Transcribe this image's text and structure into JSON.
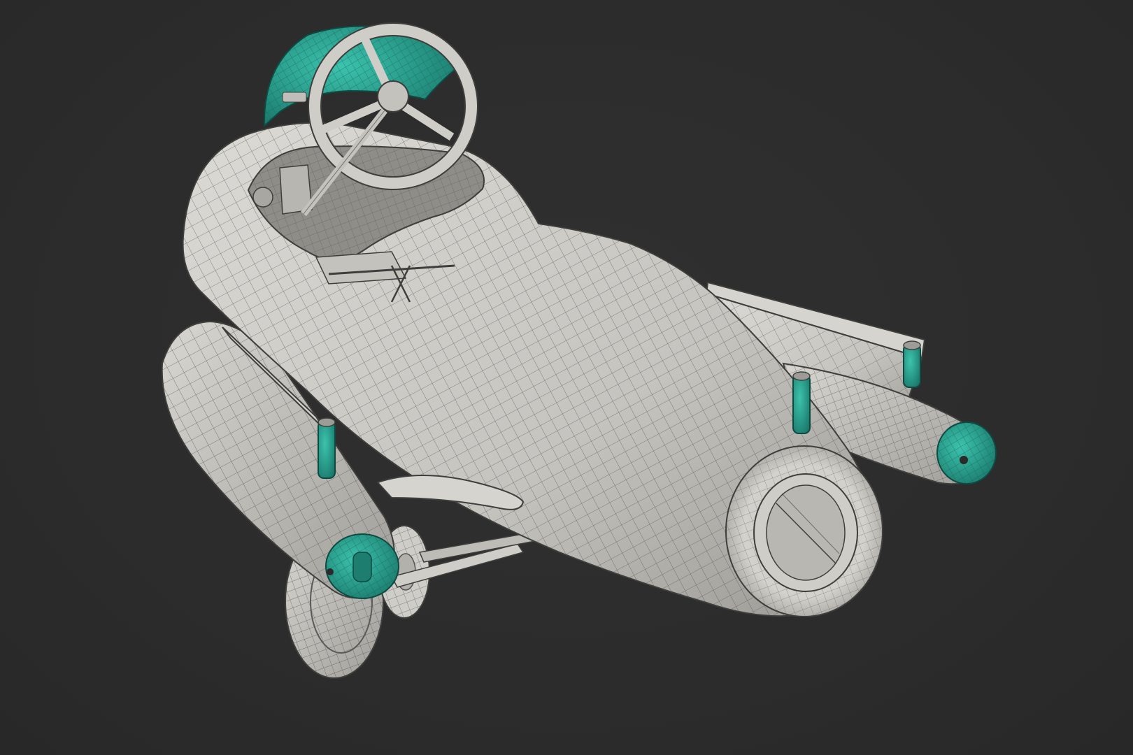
{
  "scene": {
    "subject": "pedal-car-wireframe-model",
    "colors": {
      "background": "#2d2d2d",
      "body": "#c9c7c2",
      "body_shade": "#9e9c97",
      "body_light": "#dedcd7",
      "wire": "#4a4a48",
      "accent": "#2aa896",
      "accent_dark": "#1d7e70",
      "metal": "#b8b6b1"
    },
    "icons": {
      "model": "pedal-car-model-icon"
    }
  }
}
